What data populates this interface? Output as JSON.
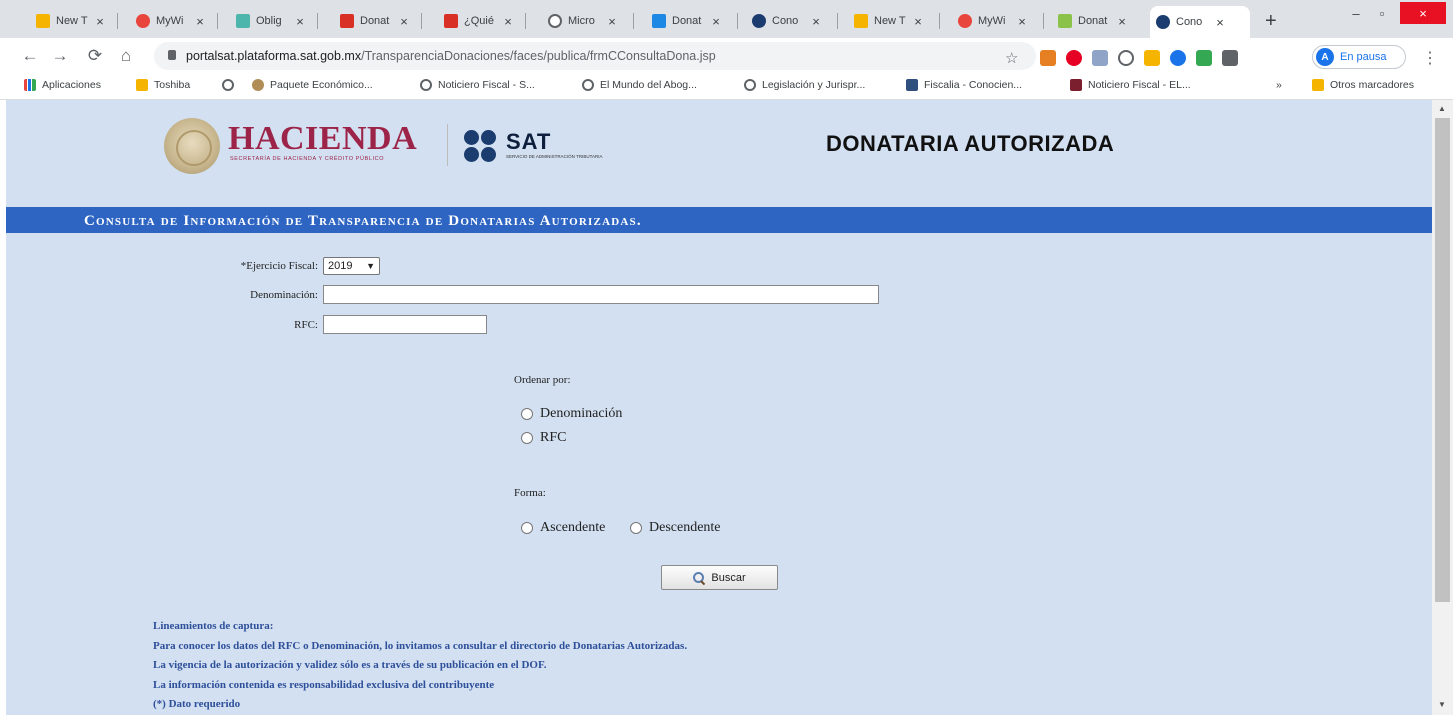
{
  "browser": {
    "tabs": [
      {
        "label": "New T",
        "color": "#f4b400",
        "icon": "download-favicon"
      },
      {
        "label": "MyWi",
        "color": "#e8453c",
        "icon": "mywi-favicon"
      },
      {
        "label": "Oblig",
        "color": "#4db6ac",
        "icon": "oblig-favicon"
      },
      {
        "label": "Donat",
        "color": "#d93025",
        "icon": "mail-favicon"
      },
      {
        "label": "¿Quié",
        "color": "#d93025",
        "icon": "mail-favicon"
      },
      {
        "label": "Micro",
        "color": "#5f6368",
        "icon": "globe-favicon"
      },
      {
        "label": "Donat",
        "color": "#1e88e5",
        "icon": "doc-favicon"
      },
      {
        "label": "Cono",
        "color": "#1a3c6e",
        "icon": "sat-favicon"
      },
      {
        "label": "New T",
        "color": "#f4b400",
        "icon": "download-favicon"
      },
      {
        "label": "MyWi",
        "color": "#e8453c",
        "icon": "mywi-favicon"
      },
      {
        "label": "Donat",
        "color": "#8bc34a",
        "icon": "sheet-favicon"
      },
      {
        "label": "Cono",
        "color": "#1a3c6e",
        "icon": "sat-favicon",
        "active": true
      }
    ],
    "url_host": "portalsat.plataforma.sat.gob.mx",
    "url_path": "/TransparenciaDonaciones/faces/publica/frmCConsultaDona.jsp",
    "profile_initial": "A",
    "profile_status": "En pausa",
    "bookmarks": [
      {
        "label": "Aplicaciones",
        "icon": "apps-icon"
      },
      {
        "label": "Toshiba",
        "icon": "folder-icon"
      },
      {
        "label": "",
        "icon": "globe-icon"
      },
      {
        "label": "Paquete Económico...",
        "icon": "seal-icon"
      },
      {
        "label": "Noticiero Fiscal - S...",
        "icon": "globe-icon"
      },
      {
        "label": "El Mundo del Abog...",
        "icon": "globe-icon"
      },
      {
        "label": "Legislación y Jurispr...",
        "icon": "globe-icon"
      },
      {
        "label": "Fiscalia - Conocien...",
        "icon": "bookmark-icon"
      },
      {
        "label": "Noticiero Fiscal - EL...",
        "icon": "bookmark-icon"
      }
    ],
    "bookmarks_overflow": "»",
    "other_bookmarks": "Otros marcadores"
  },
  "header": {
    "hacienda": "HACIENDA",
    "hacienda_sub": "SECRETARÍA DE HACIENDA Y CRÉDITO PÚBLICO",
    "sat": "SAT",
    "sat_sub": "SERVICIO DE ADMINISTRACIÓN TRIBUTARIA",
    "title": "DONATARIA AUTORIZADA"
  },
  "band_title": "Consulta de Información de Transparencia de Donatarias Autorizadas.",
  "form": {
    "ejercicio_label": "*Ejercicio Fiscal:",
    "ejercicio_value": "2019",
    "denominacion_label": "Denominación:",
    "denominacion_value": "",
    "rfc_label": "RFC:",
    "rfc_value": "",
    "ordenar_label": "Ordenar por:",
    "ordenar_options": [
      "Denominación",
      "RFC"
    ],
    "forma_label": "Forma:",
    "forma_options": [
      "Ascendente",
      "Descendente"
    ],
    "buscar_label": "Buscar"
  },
  "guidelines": [
    "Lineamientos de captura:",
    "Para conocer los datos del RFC o Denominación, lo invitamos a consultar el directorio de Donatarias Autorizadas.",
    "La vigencia de la autorización y validez sólo es a través de su publicación en el DOF.",
    "La información contenida es responsabilidad exclusiva del contribuyente",
    "(*) Dato requerido"
  ],
  "colors": {
    "page_bg": "#d2e0f1",
    "band": "#2f65c2",
    "hacienda": "#9d2449",
    "guide_text": "#2e4f9a"
  }
}
